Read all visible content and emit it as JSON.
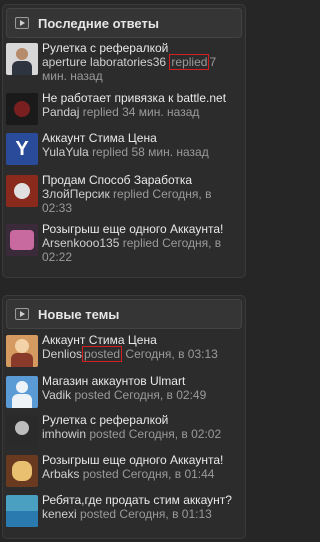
{
  "recent_replies": {
    "title": "Последние ответы",
    "items": [
      {
        "title": "Рулетка с рефералкой",
        "user": "aperture laboratories36",
        "verb": "replied",
        "time": "7 мин. назад"
      },
      {
        "title": "Не работает привязка к battle.net",
        "user": "Pandaj",
        "verb": "replied",
        "time": "34 мин. назад"
      },
      {
        "title": "Аккаунт Стима Цена",
        "user": "YulaYula",
        "verb": "replied",
        "time": "58 мин. назад"
      },
      {
        "title": "Продам Способ Заработка",
        "user": "ЗлойПерсик",
        "verb": "replied",
        "time": "Сегодня, в 02:33"
      },
      {
        "title": "Розыгрыш еще одного Аккаунта!",
        "user": "Arsenkooo135",
        "verb": "replied",
        "time": "Сегодня, в 02:22"
      }
    ]
  },
  "new_topics": {
    "title": "Новые темы",
    "items": [
      {
        "title": "Аккаунт Стима Цена",
        "user": "Denlios",
        "verb": "posted",
        "time": "Сегодня, в 03:13"
      },
      {
        "title": "Магазин аккаунтов Ulmart",
        "user": "Vadik",
        "verb": "posted",
        "time": "Сегодня, в 02:49"
      },
      {
        "title": "Рулетка с рефералкой",
        "user": "imhowin",
        "verb": "posted",
        "time": "Сегодня, в 02:02"
      },
      {
        "title": "Розыгрыш еще одного Аккаунта!",
        "user": "Arbaks",
        "verb": "posted",
        "time": "Сегодня, в 01:44"
      },
      {
        "title": "Ребята,где продать стим аккаунт?",
        "user": "kenexi",
        "verb": "posted",
        "time": "Сегодня, в 01:13"
      }
    ]
  },
  "avatar_3_letter": "Y"
}
